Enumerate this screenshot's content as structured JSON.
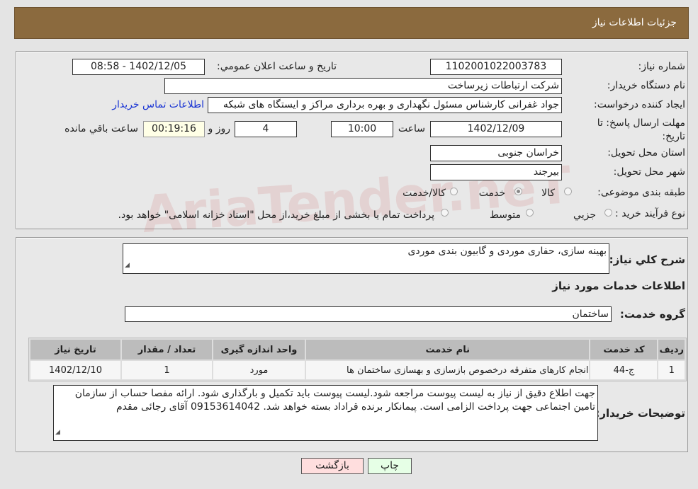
{
  "header": {
    "title": "جزئیات اطلاعات نیاز"
  },
  "watermark": "AriaTender.neT",
  "form": {
    "need_number": {
      "label": "شماره نیاز:",
      "value": "1102001022003783"
    },
    "announce": {
      "label": "تاریخ و ساعت اعلان عمومي:",
      "value": "1402/12/05 - 08:58"
    },
    "buyer": {
      "label": "نام دستگاه خریدار:",
      "value": "شرکت ارتباطات زیرساخت"
    },
    "creator": {
      "label": "ایجاد کننده درخواست:",
      "value": "جواد غفرانی کارشناس مسئول نگهداری و بهره برداری مراکز و ایستگاه های شبکه",
      "contact_link": "اطلاعات تماس خریدار"
    },
    "deadline": {
      "label": "مهلت ارسال پاسخ: تا تاریخ:",
      "date": "1402/12/09",
      "time_label": "ساعت",
      "time": "10:00",
      "days": "4",
      "days_label": "روز و",
      "remaining": "00:19:16",
      "remaining_label": "ساعت باقي مانده"
    },
    "province": {
      "label": "استان محل تحویل:",
      "value": "خراسان جنوبی"
    },
    "city": {
      "label": "شهر محل تحویل:",
      "value": "بیرجند"
    },
    "category": {
      "label": "طبقه بندی موضوعی:",
      "options": [
        "کالا",
        "خدمت",
        "کالا/خدمت"
      ],
      "selected": "خدمت"
    },
    "process": {
      "label": "نوع فرآیند خرید :",
      "options": [
        "جزيي",
        "متوسط"
      ],
      "note": "پرداخت تمام یا بخشی از مبلغ خرید،از محل \"اسناد خزانه اسلامی\" خواهد بود."
    }
  },
  "details": {
    "summary_label": "شرح کلي نیاز:",
    "summary": "بهینه سازی، حفاری موردی و گابیون بندی موردی",
    "services_title": "اطلاعات خدمات مورد نیاز",
    "group_label": "گروه خدمت:",
    "group": "ساختمان",
    "table": {
      "headers": [
        "ردیف",
        "کد خدمت",
        "نام خدمت",
        "واحد اندازه گیری",
        "تعداد / مقدار",
        "تاریخ نیاز"
      ],
      "rows": [
        [
          "1",
          "ج-44",
          "انجام کارهای متفرقه درخصوص بازسازی و بهسازی ساختمان ها",
          "مورد",
          "1",
          "1402/12/10"
        ]
      ]
    },
    "desc_label": "توضیحات خریدار:",
    "desc": "جهت اطلاع دقیق از نیاز به لیست پیوست مراجعه شود.لیست پیوست باید تکمیل و بارگذاری شود. ارائه مفصا حساب از سازمان تامین اجتماعی جهت پرداخت الزامی است. پیمانکار برنده قراداد بسته خواهد شد. 09153614042 آقای رجائی مقدم"
  },
  "buttons": {
    "print": "چاپ",
    "back": "بازگشت"
  }
}
